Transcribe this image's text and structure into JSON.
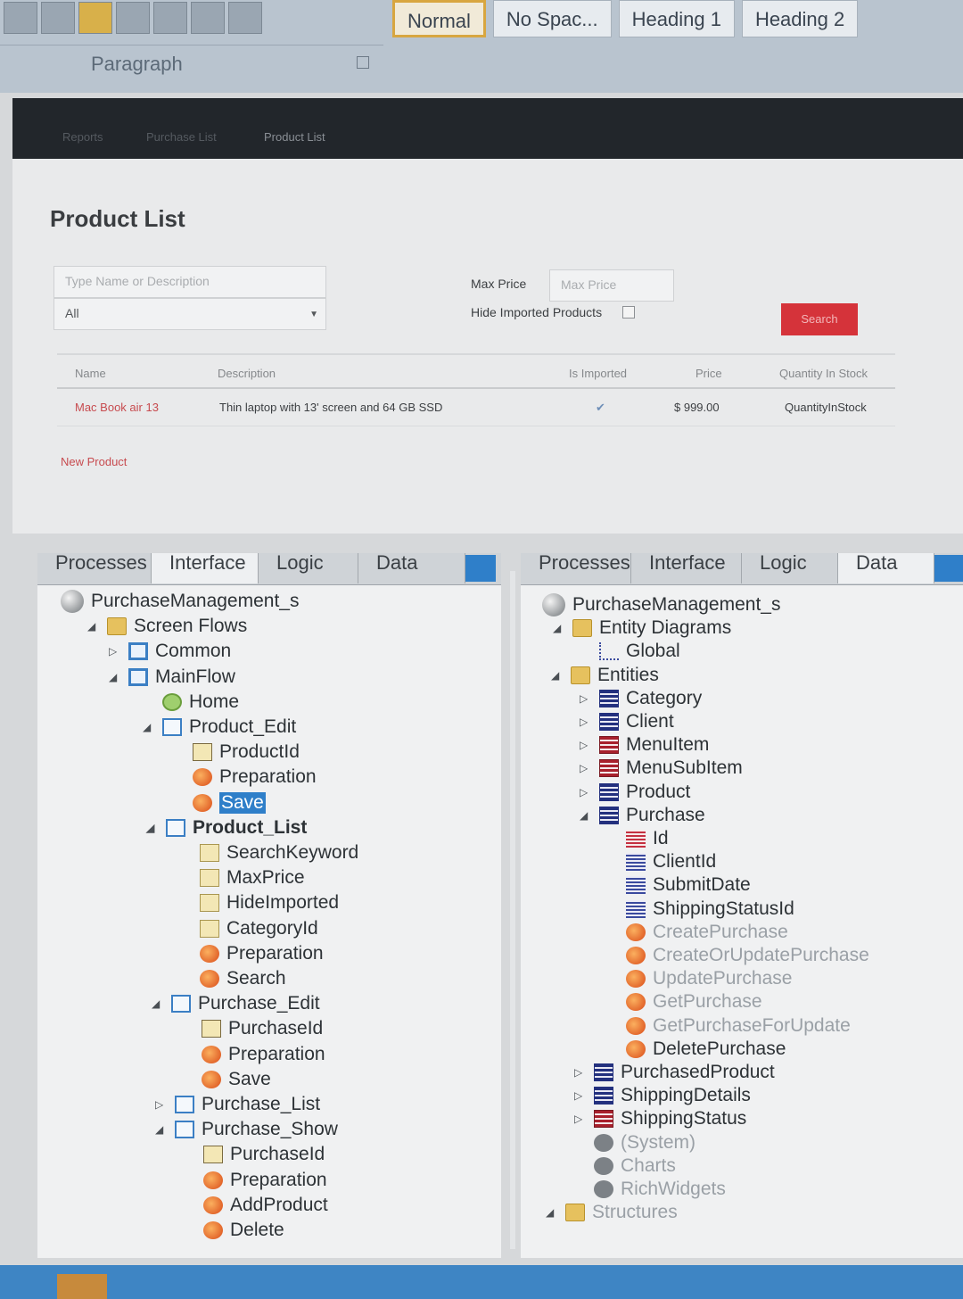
{
  "ribbon": {
    "styles": [
      "Normal",
      "No Spac...",
      "Heading 1",
      "Heading 2"
    ],
    "group_label": "Paragraph"
  },
  "webnav": {
    "items": [
      "Reports",
      "Purchase List",
      "Product List"
    ]
  },
  "product_page": {
    "title": "Product List",
    "search_placeholder": "Type Name or Description",
    "category_selected": "All",
    "max_price_label": "Max Price",
    "max_price_placeholder": "Max Price",
    "hide_imported_label": "Hide Imported Products",
    "search_button": "Search",
    "columns": [
      "Name",
      "Description",
      "Is Imported",
      "Price",
      "Quantity In Stock"
    ],
    "rows": [
      {
        "name": "Mac Book air 13",
        "description": "Thin laptop with 13' screen and 64 GB SSD",
        "imported": "✔",
        "price": "$ 999.00",
        "quantity": "QuantityInStock"
      }
    ],
    "new_product_link": "New Product"
  },
  "left_panel": {
    "tabs": [
      "Processes",
      "Interface",
      "Logic",
      "Data"
    ],
    "nodes": [
      {
        "label": "PurchaseManagement_s",
        "icon": "globe"
      },
      {
        "label": "Screen Flows",
        "icon": "folder"
      },
      {
        "label": "Common",
        "icon": "flow"
      },
      {
        "label": "MainFlow",
        "icon": "flow"
      },
      {
        "label": "Home",
        "icon": "home"
      },
      {
        "label": "Product_Edit",
        "icon": "screen"
      },
      {
        "label": "ProductId",
        "icon": "input"
      },
      {
        "label": "Preparation",
        "icon": "action"
      },
      {
        "label": "Save",
        "icon": "action"
      },
      {
        "label": "Product_List",
        "icon": "screen"
      },
      {
        "label": "SearchKeyword",
        "icon": "var"
      },
      {
        "label": "MaxPrice",
        "icon": "var"
      },
      {
        "label": "HideImported",
        "icon": "var"
      },
      {
        "label": "CategoryId",
        "icon": "var"
      },
      {
        "label": "Preparation",
        "icon": "action"
      },
      {
        "label": "Search",
        "icon": "action"
      },
      {
        "label": "Purchase_Edit",
        "icon": "screen"
      },
      {
        "label": "PurchaseId",
        "icon": "input"
      },
      {
        "label": "Preparation",
        "icon": "action"
      },
      {
        "label": "Save",
        "icon": "action"
      },
      {
        "label": "Purchase_List",
        "icon": "screen"
      },
      {
        "label": "Purchase_Show",
        "icon": "screen"
      },
      {
        "label": "PurchaseId",
        "icon": "input"
      },
      {
        "label": "Preparation",
        "icon": "action"
      },
      {
        "label": "AddProduct",
        "icon": "action"
      },
      {
        "label": "Delete",
        "icon": "action"
      }
    ]
  },
  "right_panel": {
    "tabs": [
      "Processes",
      "Interface",
      "Logic",
      "Data"
    ],
    "nodes": [
      {
        "label": "PurchaseManagement_s",
        "icon": "globe"
      },
      {
        "label": "Entity Diagrams",
        "icon": "folder"
      },
      {
        "label": "Global",
        "icon": "diagram"
      },
      {
        "label": "Entities",
        "icon": "folder"
      },
      {
        "label": "Category",
        "icon": "entity"
      },
      {
        "label": "Client",
        "icon": "entity"
      },
      {
        "label": "MenuItem",
        "icon": "entity-red"
      },
      {
        "label": "MenuSubItem",
        "icon": "entity-red"
      },
      {
        "label": "Product",
        "icon": "entity"
      },
      {
        "label": "Purchase",
        "icon": "entity"
      },
      {
        "label": "Id",
        "icon": "attr-red"
      },
      {
        "label": "ClientId",
        "icon": "attr"
      },
      {
        "label": "SubmitDate",
        "icon": "attr"
      },
      {
        "label": "ShippingStatusId",
        "icon": "attr"
      },
      {
        "label": "CreatePurchase",
        "icon": "action"
      },
      {
        "label": "CreateOrUpdatePurchase",
        "icon": "action"
      },
      {
        "label": "UpdatePurchase",
        "icon": "action"
      },
      {
        "label": "GetPurchase",
        "icon": "action"
      },
      {
        "label": "GetPurchaseForUpdate",
        "icon": "action"
      },
      {
        "label": "DeletePurchase",
        "icon": "action"
      },
      {
        "label": "PurchasedProduct",
        "icon": "entity"
      },
      {
        "label": "ShippingDetails",
        "icon": "entity"
      },
      {
        "label": "ShippingStatus",
        "icon": "entity-red"
      },
      {
        "label": "(System)",
        "icon": "sys"
      },
      {
        "label": "Charts",
        "icon": "sys"
      },
      {
        "label": "RichWidgets",
        "icon": "sys"
      },
      {
        "label": "Structures",
        "icon": "folder"
      }
    ]
  },
  "colors": {
    "accent": "#2f7fc9",
    "search_button": "#d5333a",
    "link": "#c74b4f",
    "taskbar": "#3e85c4"
  }
}
